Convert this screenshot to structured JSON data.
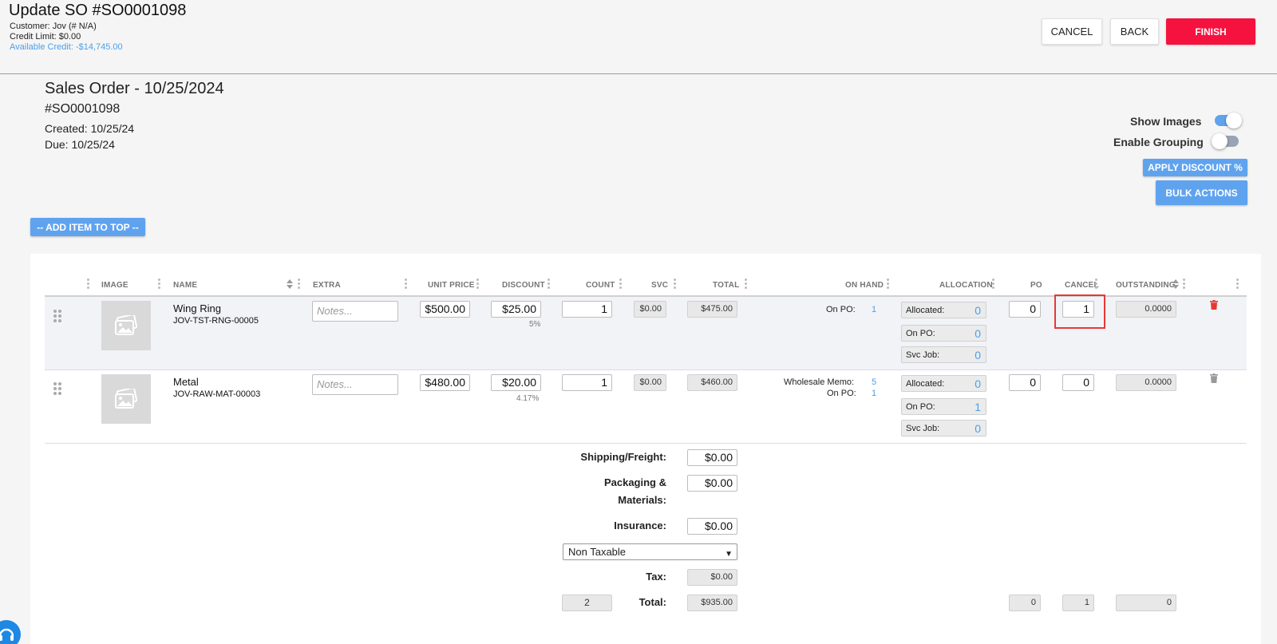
{
  "header": {
    "title": "Update SO #SO0001098",
    "customer": "Customer: Jov (# N/A)",
    "credit_limit": "Credit Limit: $0.00",
    "available_credit": "Available Credit: -$14,745.00",
    "cancel_label": "CANCEL",
    "back_label": "BACK",
    "finish_label": "FINISH"
  },
  "order": {
    "title": "Sales Order - 10/25/2024",
    "number": "#SO0001098",
    "created": "Created: 10/25/24",
    "due": "Due: 10/25/24"
  },
  "options": {
    "show_images_label": "Show Images",
    "show_images_on": true,
    "enable_grouping_label": "Enable Grouping",
    "enable_grouping_on": false,
    "apply_discount_label": "APPLY DISCOUNT %",
    "bulk_actions_label": "BULK ACTIONS",
    "add_item_label": "-- ADD ITEM TO TOP --"
  },
  "table": {
    "columns": [
      "IMAGE",
      "NAME",
      "EXTRA",
      "UNIT PRICE",
      "DISCOUNT",
      "COUNT",
      "SVC",
      "TOTAL",
      "ON HAND",
      "ALLOCATION",
      "PO",
      "CANCEL",
      "OUTSTANDING"
    ],
    "rows": [
      {
        "name": "Wing Ring",
        "sku": "JOV-TST-RNG-00005",
        "notes_placeholder": "Notes...",
        "unit_price": "$500.00",
        "discount": "$25.00",
        "discount_pct": "5%",
        "count": "1",
        "svc": "$0.00",
        "total": "$475.00",
        "on_hand": [
          {
            "label": "On PO:",
            "value": "1"
          }
        ],
        "allocated_label": "Allocated:",
        "allocated": "0",
        "on_po_label": "On PO:",
        "on_po": "0",
        "svc_job_label": "Svc Job:",
        "svc_job": "0",
        "po": "0",
        "cancel": "1",
        "outstanding": "0.0000"
      },
      {
        "name": "Metal",
        "sku": "JOV-RAW-MAT-00003",
        "notes_placeholder": "Notes...",
        "unit_price": "$480.00",
        "discount": "$20.00",
        "discount_pct": "4.17%",
        "count": "1",
        "svc": "$0.00",
        "total": "$460.00",
        "on_hand": [
          {
            "label": "Wholesale Memo:",
            "value": "5"
          },
          {
            "label": "On PO:",
            "value": "1"
          }
        ],
        "allocated_label": "Allocated:",
        "allocated": "0",
        "on_po_label": "On PO:",
        "on_po": "1",
        "svc_job_label": "Svc Job:",
        "svc_job": "0",
        "po": "0",
        "cancel": "0",
        "outstanding": "0.0000"
      }
    ]
  },
  "footer": {
    "shipping_label": "Shipping/Freight:",
    "shipping": "$0.00",
    "packaging_label_1": "Packaging &",
    "packaging_label_2": "Materials:",
    "packaging": "$0.00",
    "insurance_label": "Insurance:",
    "insurance": "$0.00",
    "tax_option": "Non Taxable",
    "tax_label": "Tax:",
    "tax": "$0.00",
    "total_label": "Total:",
    "total_count": "2",
    "total": "$935.00",
    "total_po": "0",
    "total_cancel": "1",
    "total_outstanding": "0"
  },
  "colors": {
    "finish": "#f5123f",
    "primary_blue": "#5fa3ef",
    "link_blue": "#4a9fe8",
    "highlight": "#e53935"
  }
}
